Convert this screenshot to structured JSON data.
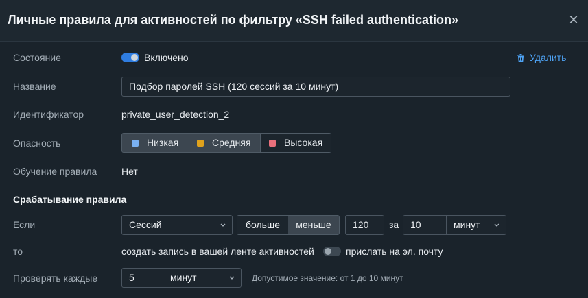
{
  "dialog": {
    "title": "Личные правила для активностей по фильтру «SSH failed authentication»",
    "close_glyph": "✕"
  },
  "state": {
    "label": "Состояние",
    "value": "Включено",
    "enabled": true
  },
  "delete_label": "Удалить",
  "name": {
    "label": "Название",
    "value": "Подбор паролей SSH (120 сессий за 10 минут)"
  },
  "identifier": {
    "label": "Идентификатор",
    "value": "private_user_detection_2"
  },
  "severity": {
    "label": "Опасность",
    "options": [
      {
        "label": "Низкая",
        "color": "#7ab1f2"
      },
      {
        "label": "Средняя",
        "color": "#e0a21c"
      },
      {
        "label": "Высокая",
        "color": "#e9707c"
      }
    ],
    "selected": "Высокая"
  },
  "learning": {
    "label": "Обучение правила",
    "value": "Нет"
  },
  "trigger": {
    "section_title": "Срабатывание правила",
    "if_label": "Если",
    "metric": "Сессий",
    "compare_options": [
      "больше",
      "меньше"
    ],
    "compare_selected": "больше",
    "threshold": "120",
    "for_label": "за",
    "period": "10",
    "period_unit": "минут",
    "then_label": "то",
    "then_action": "создать запись в вашей ленте активностей",
    "email_label": "прислать на эл. почту",
    "email_enabled": false,
    "check_label": "Проверять каждые",
    "check_value": "5",
    "check_unit": "минут",
    "check_hint": "Допустимое значение: от 1 до 10 минут"
  },
  "colors": {
    "accent": "#2f7de1",
    "link": "#4ea3f5",
    "background": "#1a232b"
  }
}
